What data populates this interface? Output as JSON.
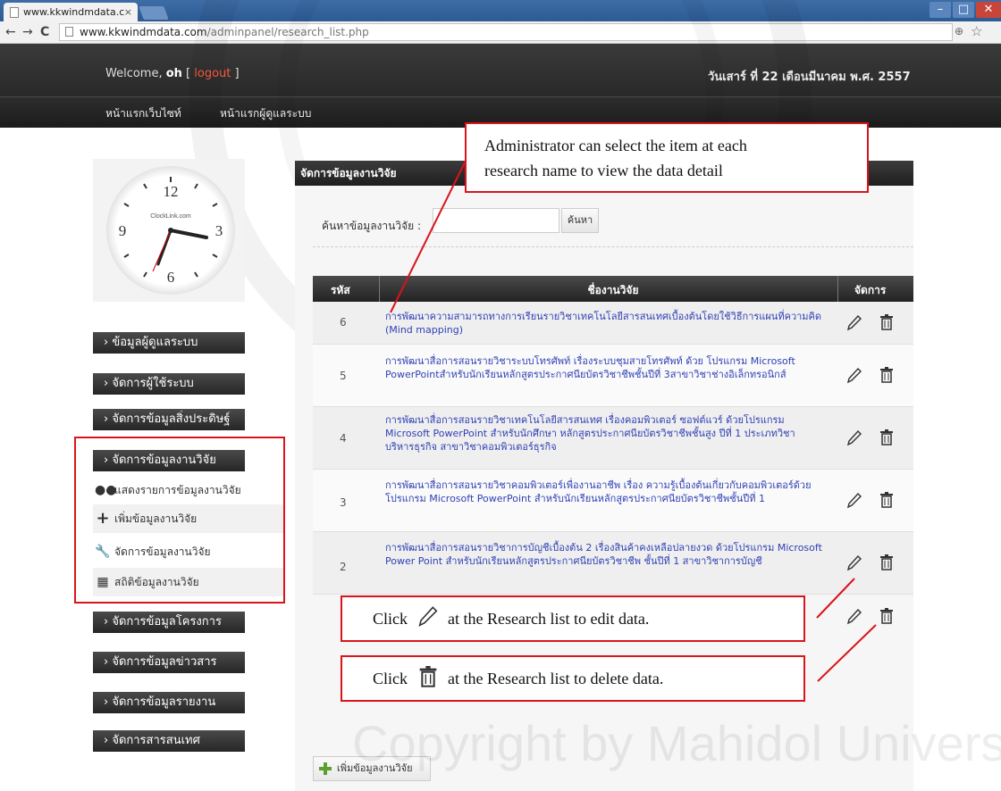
{
  "browser": {
    "tab_title": "www.kkwindmdata.c",
    "tab_close": "×",
    "url_host": "www.kkwindmdata.com",
    "url_path": "/adminpanel/research_list.php"
  },
  "header": {
    "welcome_prefix": "Welcome, ",
    "username": "oh",
    "logout_open": " [ ",
    "logout_label": "logout",
    "logout_close": " ]",
    "date": "วันเสาร์ ที่ 22 เดือนมีนาคม พ.ศ. 2557",
    "nav": [
      "หน้าแรกเว็บไซท์",
      "หน้าแรกผู้ดูแลระบบ"
    ]
  },
  "clock": {
    "brand": "ClockLink.com",
    "numerals": [
      "12",
      "3",
      "6",
      "9"
    ]
  },
  "sidebar": {
    "items": [
      "› ข้อมูลผู้ดูแลระบบ",
      "› จัดการผู้ใช้ระบบ",
      "› จัดการข้อมูลสิ่งประดิษฐ์",
      "› จัดการข้อมูลงานวิจัย",
      "› จัดการข้อมูลโครงการ",
      "› จัดการข้อมูลข่าวสาร",
      "› จัดการข้อมูลรายงาน",
      "› จัดการสารสนเทศ"
    ],
    "subitems": [
      {
        "label": "แสดงรายการข้อมูลงานวิจัย",
        "icon": "users-icon"
      },
      {
        "label": "เพิ่มข้อมูลงานวิจัย",
        "icon": "plus-icon"
      },
      {
        "label": "จัดการข้อมูลงานวิจัย",
        "icon": "wrench-icon"
      },
      {
        "label": "สถิติข้อมูลงานวิจัย",
        "icon": "calculator-icon"
      }
    ]
  },
  "main": {
    "title": "จัดการข้อมูลงานวิจัย",
    "search_label": "ค้นหาข้อมูลงานวิจัย :",
    "search_value": "",
    "search_button": "ค้นหา",
    "columns": [
      "รหัส",
      "ชื่องานวิจัย",
      "จัดการ"
    ],
    "rows": [
      {
        "id": "6",
        "name": "การพัฒนาความสามารถทางการเรียนรายวิชาเทคโนโลยีสารสนเทศเบื้องต้นโดยใช้วิธีการแผนที่ความคิด (Mind mapping)"
      },
      {
        "id": "5",
        "name": "การพัฒนาสื่อการสอนรายวิชาระบบโทรศัพท์ เรื่องระบบชุมสายโทรศัพท์ ด้วย โปรแกรม Microsoft PowerPointสำหรับนักเรียนหลักสูตรประกาศนียบัตรวิชาชีพชั้นปีที่ 3สาขาวิชาช่างอิเล็กทรอนิกส์"
      },
      {
        "id": "4",
        "name": "การพัฒนาสื่อการสอนรายวิชาเทคโนโลยีสารสนเทศ เรื่องคอมพิวเตอร์ ซอฟต์แวร์ ด้วยโปรแกรม Microsoft PowerPoint สำหรับนักศึกษา หลักสูตรประกาศนียบัตรวิชาชีพชั้นสูง ปีที่ 1 ประเภทวิชาบริหารธุรกิจ สาขาวิชาคอมพิวเตอร์ธุรกิจ"
      },
      {
        "id": "3",
        "name": "การพัฒนาสื่อการสอนรายวิชาคอมพิวเตอร์เพื่องานอาชีพ เรื่อง ความรู้เบื้องต้นเกี่ยวกับคอมพิวเตอร์ด้วยโปรแกรม Microsoft PowerPoint สำหรับนักเรียนหลักสูตรประกาศนียบัตรวิชาชีพชั้นปีที่ 1"
      },
      {
        "id": "2",
        "name": "การพัฒนาสื่อการสอนรายวิชาการบัญชีเบื้องต้น 2 เรื่องสินค้าคงเหลือปลายงวด ด้วยโปรแกรม Microsoft Power Point สำหรับนักเรียนหลักสูตรประกาศนียบัตรวิชาชีพ ชั้นปีที่ 1 สาขาวิชาการบัญชี"
      }
    ],
    "add_button": "เพิ่มข้อมูลงานวิจัย"
  },
  "annotations": {
    "top": [
      "Administrator can select the item at each",
      "research name to view the data detail"
    ],
    "edit_prefix": "Click",
    "edit_suffix": "at the Research list to edit data.",
    "delete_prefix": "Click",
    "delete_suffix": "at the Research list to delete data."
  },
  "watermark": "Copyright by Mahidol University",
  "colors": {
    "highlight_red": "#d9141b",
    "link_blue": "#3041b5",
    "logout_orange": "#ff5a3c"
  }
}
